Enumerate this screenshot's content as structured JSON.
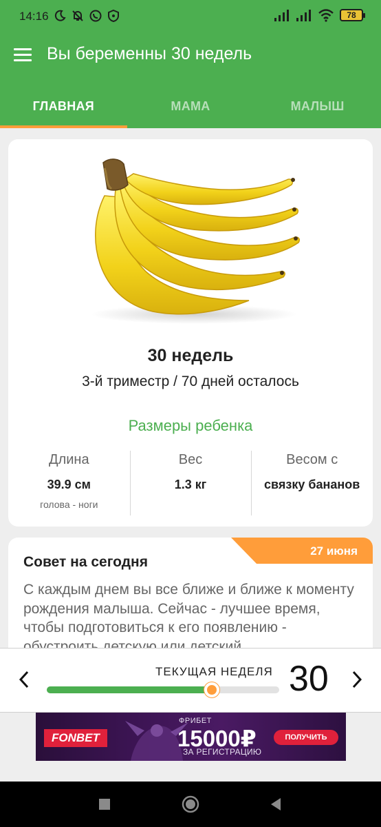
{
  "status_bar": {
    "time": "14:16",
    "left_icons": [
      "moon-icon",
      "bell-off-icon",
      "whatsapp-icon",
      "shield-icon"
    ],
    "right_icons": [
      "signal-icon",
      "signal-icon",
      "wifi-icon"
    ],
    "battery": "78"
  },
  "app_bar": {
    "title": "Вы беременны 30 недель"
  },
  "tabs": [
    {
      "label": "ГЛАВНАЯ",
      "active": true
    },
    {
      "label": "МАМА",
      "active": false
    },
    {
      "label": "МАЛЫШ",
      "active": false
    }
  ],
  "fruit_card": {
    "image": "banana-bunch",
    "week_title": "30 недель",
    "subtitle": "3-й триместр / 70 дней осталось",
    "sizes_heading": "Размеры ребенка",
    "sizes": [
      {
        "label": "Длина",
        "value": "39.9 см",
        "note": "голова - ноги"
      },
      {
        "label": "Вес",
        "value": "1.3 кг",
        "note": ""
      },
      {
        "label": "Весом с",
        "value": "связку бананов",
        "note": ""
      }
    ]
  },
  "tip_card": {
    "date": "27 июня",
    "title": "Совет на сегодня",
    "text": "С каждым днем вы все ближе и ближе к моменту рождения малыша. Сейчас - лучшее время, чтобы подготовиться к его появлению - обустроить детскую или детский"
  },
  "week_selector": {
    "label": "ТЕКУЩАЯ НЕДЕЛЯ",
    "current_week": "30",
    "progress": 0.71
  },
  "ad": {
    "logo": "FONBET",
    "small_text": "ФРИБЕТ",
    "amount": "15000₽",
    "subtext": "ЗА РЕГИСТРАЦИЮ",
    "button": "ПОЛУЧИТЬ"
  },
  "colors": {
    "primary": "#4caf50",
    "accent": "#ff9d3a",
    "background": "#eeeeee"
  }
}
